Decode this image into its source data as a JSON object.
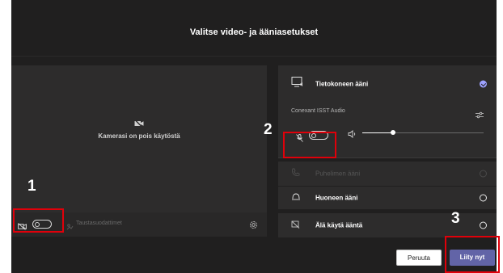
{
  "header": {
    "title": "Valitse video- ja ääniasetukset"
  },
  "video": {
    "status_text": "Kamerasi on pois käytöstä",
    "camera_toggle": "off",
    "background_filters_label": "Taustasuodattimet"
  },
  "audio": {
    "options": [
      {
        "label": "Tietokoneen ääni",
        "selected": true,
        "enabled": true,
        "icon": "computer-audio-icon"
      },
      {
        "label": "Puhelimen ääni",
        "selected": false,
        "enabled": false,
        "icon": "phone-icon"
      },
      {
        "label": "Huoneen ääni",
        "selected": false,
        "enabled": true,
        "icon": "room-audio-icon"
      },
      {
        "label": "Älä käytä ääntä",
        "selected": false,
        "enabled": true,
        "icon": "no-audio-icon"
      }
    ],
    "device_name": "Conexant ISST Audio",
    "mic_toggle": "off",
    "speaker_volume": 0.25
  },
  "buttons": {
    "cancel": "Peruuta",
    "join": "Liity nyt"
  },
  "annotations": [
    "1",
    "2",
    "3"
  ],
  "colors": {
    "background": "#201f1f",
    "panel": "#2d2c2c",
    "accent": "#6264a7",
    "annotation": "#e0000a"
  }
}
